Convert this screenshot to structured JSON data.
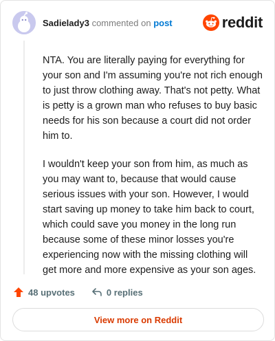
{
  "header": {
    "username": "Sadielady3",
    "commented_on": "commented on",
    "post_link": "post",
    "brand": "reddit"
  },
  "comment": {
    "paragraphs": [
      "NTA. You are literally paying for everything for your son and I'm assuming you're not rich enough to just throw clothing away. That's not petty. What is petty is a grown man who refuses to buy basic needs for his son because a court did not order him to.",
      "I wouldn't keep your son from him, as much as you may want to, because that would cause serious issues with your son. However, I would start saving up money to take him back to court, which could save you money in the long run because some of these minor losses you're experiencing now with the missing clothing will get more and more expensive as your son ages."
    ]
  },
  "actions": {
    "upvotes": "48 upvotes",
    "replies": "0 replies"
  },
  "footer": {
    "view_more": "View more on Reddit"
  },
  "colors": {
    "brand_orange": "#ff4500",
    "link_blue": "#0079d3",
    "view_more_red": "#d93a00"
  }
}
